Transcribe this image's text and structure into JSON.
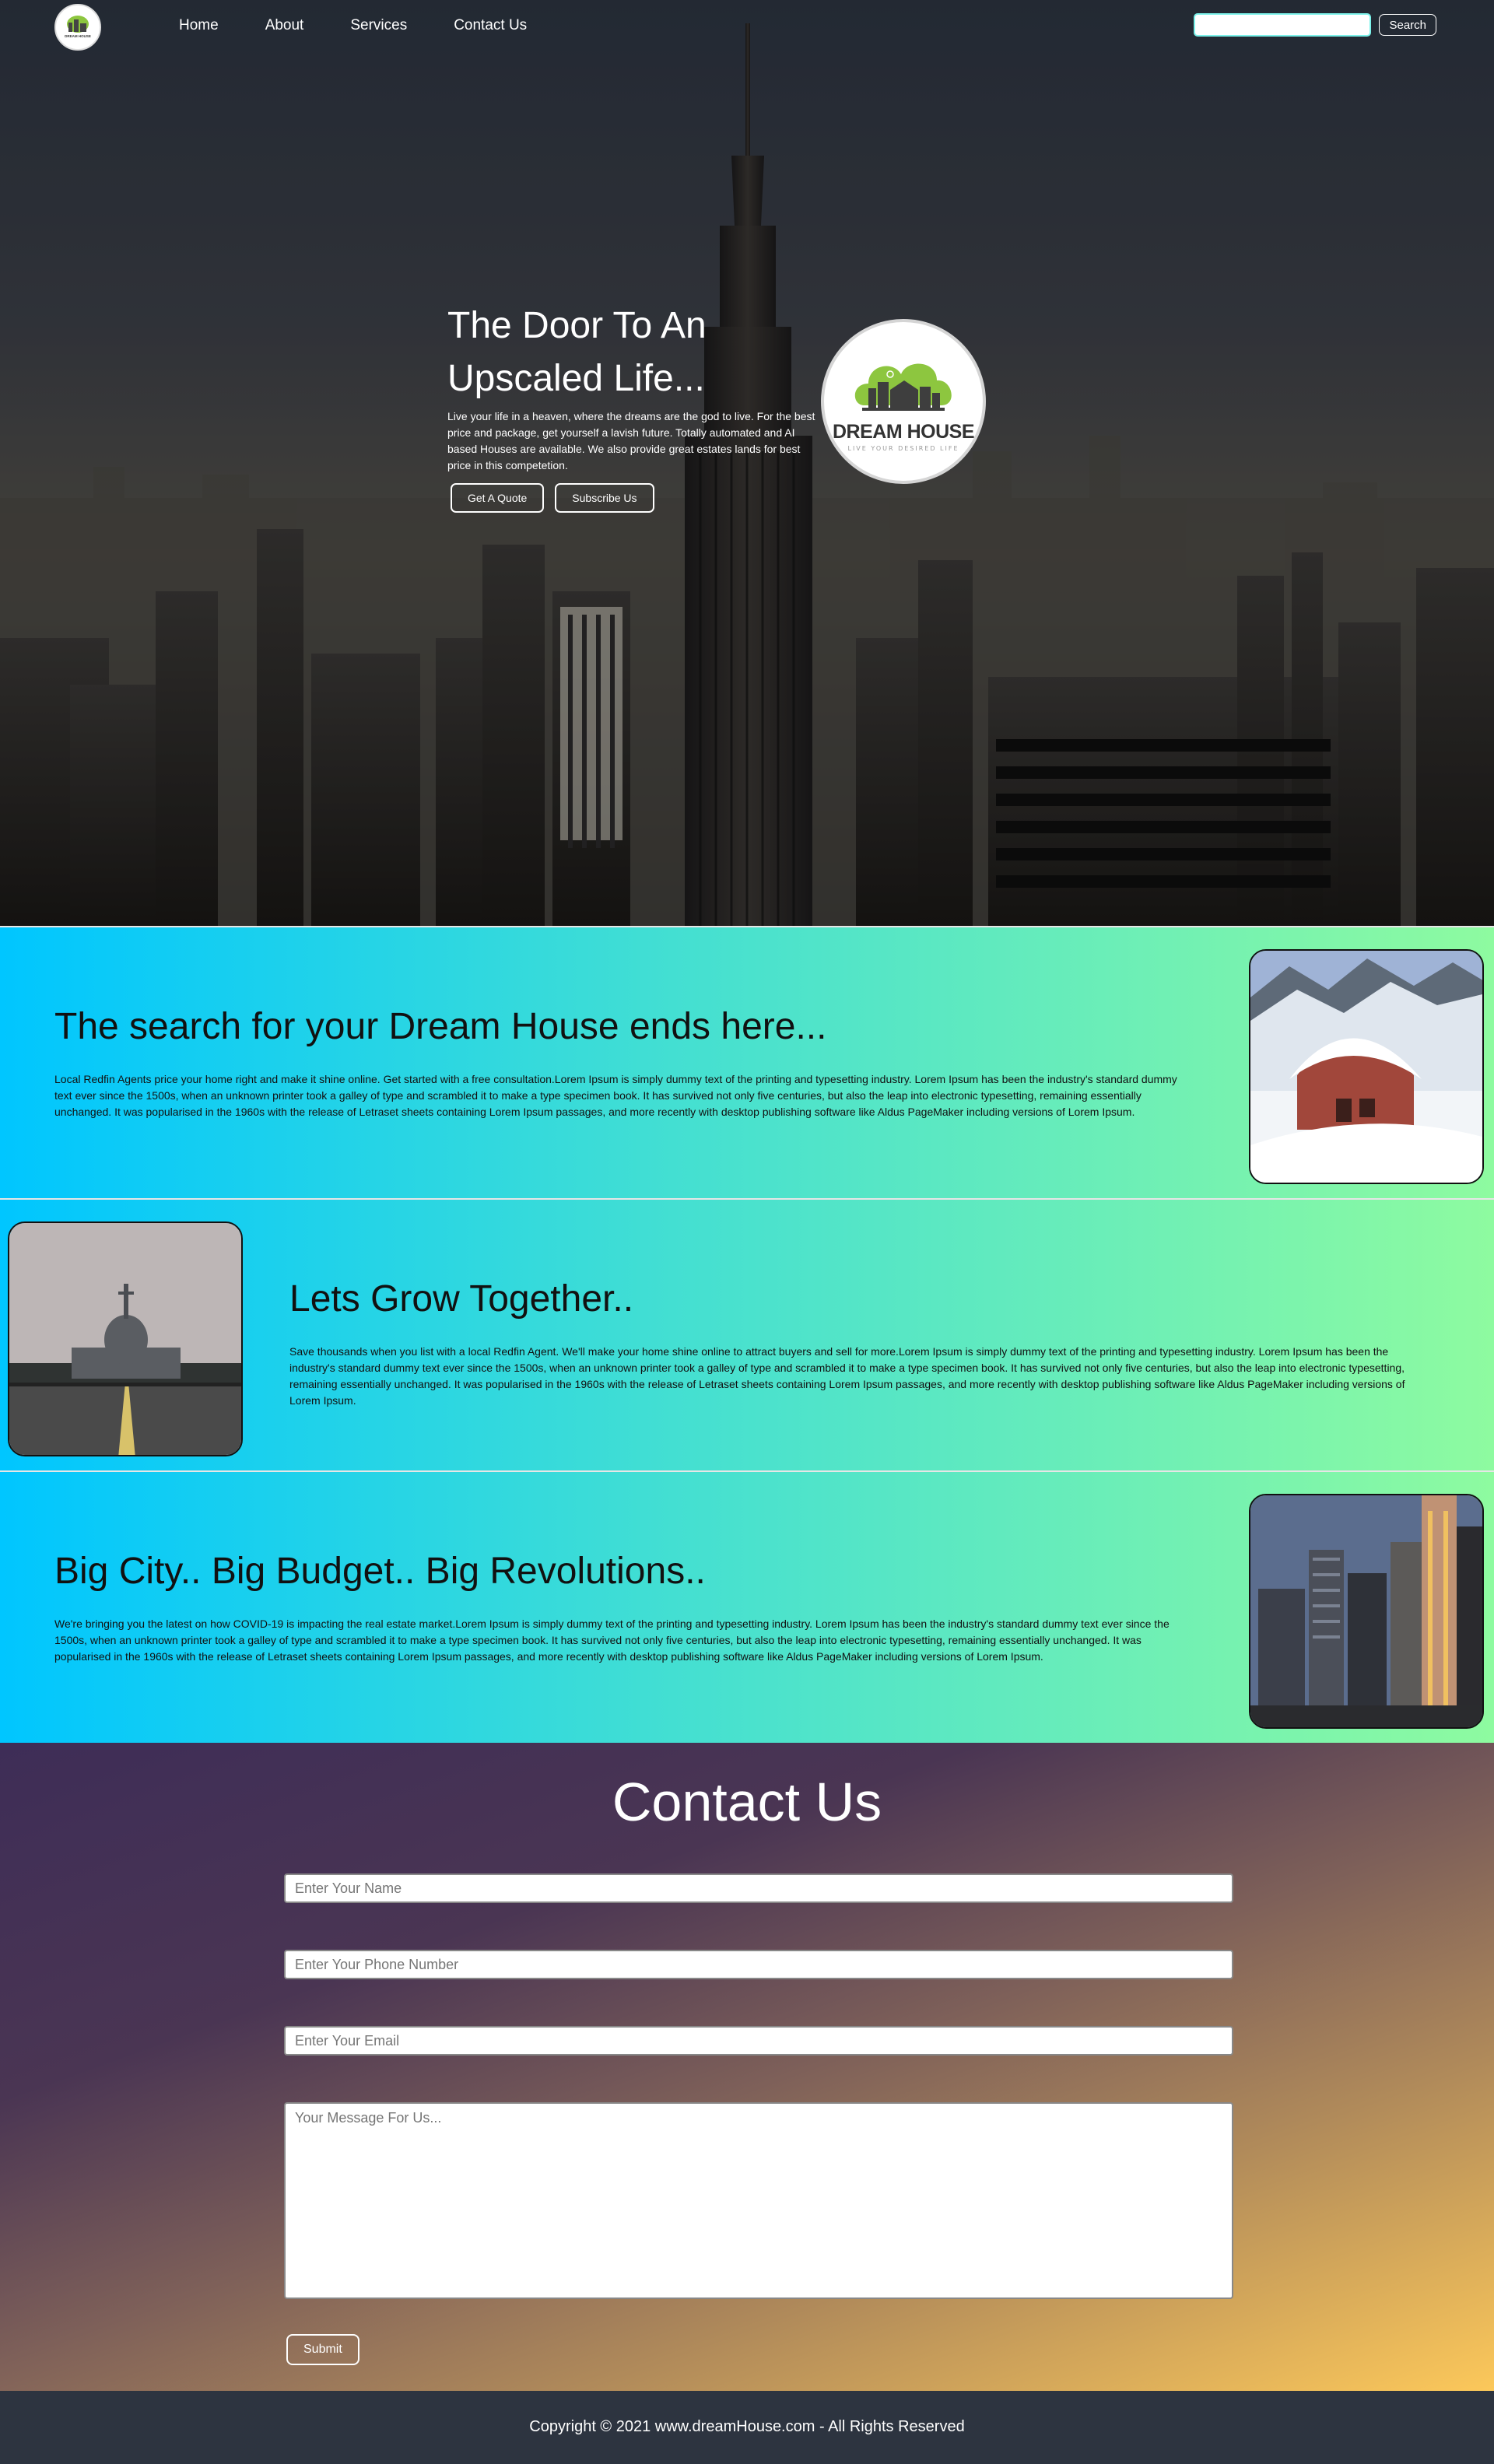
{
  "nav": {
    "links": [
      "Home",
      "About",
      "Services",
      "Contact Us"
    ],
    "search_placeholder": "",
    "search_button": "Search",
    "logo_text": "DREAM HOUSE"
  },
  "hero": {
    "title_line1": "The Door To An",
    "title_line2": "Upscaled Life...",
    "text": "Live your life in a heaven, where the dreams are the god to live. For the best price and package, get yourself a lavish future. Totally automated and AI based Houses are available. We also provide great estates lands for best price in this competetion.",
    "button_quote": "Get A Quote",
    "button_subscribe": "Subscribe Us",
    "logo_brand": "DREAM HOUSE",
    "logo_tagline": "LIVE YOUR DESIRED LIFE"
  },
  "features": [
    {
      "title": "The search for your Dream House ends here...",
      "body": "Local Redfin Agents price your home right and make it shine online. Get started with a free consultation.Lorem Ipsum is simply dummy text of the printing and typesetting industry. Lorem Ipsum has been the industry's standard dummy text ever since the 1500s, when an unknown printer took a galley of type and scrambled it to make a type specimen book. It has survived not only five centuries, but also the leap into electronic typesetting, remaining essentially unchanged. It was popularised in the 1960s with the release of Letraset sheets containing Lorem Ipsum passages, and more recently with desktop publishing software like Aldus PageMaker including versions of Lorem Ipsum."
    },
    {
      "title": "Lets Grow Together..",
      "body": "Save thousands when you list with a local Redfin Agent. We'll make your home shine online to attract buyers and sell for more.Lorem Ipsum is simply dummy text of the printing and typesetting industry. Lorem Ipsum has been the industry's standard dummy text ever since the 1500s, when an unknown printer took a galley of type and scrambled it to make a type specimen book. It has survived not only five centuries, but also the leap into electronic typesetting, remaining essentially unchanged. It was popularised in the 1960s with the release of Letraset sheets containing Lorem Ipsum passages, and more recently with desktop publishing software like Aldus PageMaker including versions of Lorem Ipsum."
    },
    {
      "title": "Big City.. Big Budget.. Big Revolutions..",
      "body": "We're bringing you the latest on how COVID-19 is impacting the real estate market.Lorem Ipsum is simply dummy text of the printing and typesetting industry. Lorem Ipsum has been the industry's standard dummy text ever since the 1500s, when an unknown printer took a galley of type and scrambled it to make a type specimen book. It has survived not only five centuries, but also the leap into electronic typesetting, remaining essentially unchanged. It was popularised in the 1960s with the release of Letraset sheets containing Lorem Ipsum passages, and more recently with desktop publishing software like Aldus PageMaker including versions of Lorem Ipsum."
    }
  ],
  "contact": {
    "title": "Contact Us",
    "name_placeholder": "Enter Your Name",
    "phone_placeholder": "Enter Your Phone Number",
    "email_placeholder": "Enter Your Email",
    "message_placeholder": "Your Message For Us...",
    "submit": "Submit"
  },
  "footer": {
    "text": "Copyright © 2021 www.dreamHouse.com - All Rights Reserved"
  },
  "colors": {
    "feature_gradient_start": "#00c6ff",
    "feature_gradient_end": "#8efba0",
    "contact_gradient_start": "#3e2d57",
    "contact_gradient_end": "#fcc85a",
    "footer_bg": "#2d3440",
    "logo_green": "#8dc63f"
  }
}
